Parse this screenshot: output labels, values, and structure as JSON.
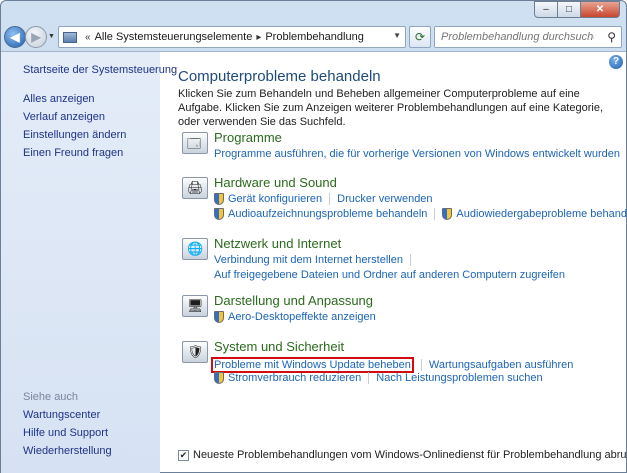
{
  "window": {
    "buttons": {
      "minimize": "–",
      "maximize": "□",
      "close": "✕"
    }
  },
  "address": {
    "crumbs": [
      "Alle Systemsteuerungselemente",
      "Problembehandlung"
    ],
    "overflow": "«"
  },
  "search": {
    "placeholder": "Problembehandlung durchsuchen"
  },
  "sidebar": {
    "home": "Startseite der Systemsteuerung",
    "links": [
      "Alles anzeigen",
      "Verlauf anzeigen",
      "Einstellungen ändern",
      "Einen Freund fragen"
    ],
    "see_also_title": "Siehe auch",
    "see_also": [
      "Wartungscenter",
      "Hilfe und Support",
      "Wiederherstellung"
    ]
  },
  "main": {
    "title": "Computerprobleme behandeln",
    "description": "Klicken Sie zum Behandeln und Beheben allgemeiner Computerprobleme auf eine Aufgabe. Klicken Sie zum Anzeigen weiterer Problembehandlungen auf eine Kategorie, oder verwenden Sie das Suchfeld.",
    "categories": [
      {
        "title": "Programme",
        "icon": "programs-icon",
        "links": [
          [
            "Programme ausführen, die für vorherige Versionen von Windows entwickelt wurden"
          ]
        ]
      },
      {
        "title": "Hardware und Sound",
        "icon": "hardware-sound-icon",
        "links": [
          [
            "Gerät konfigurieren",
            "Drucker verwenden"
          ],
          [
            "Audioaufzeichnungsprobleme behandeln",
            "Audiowiedergabeprobleme behandeln"
          ]
        ]
      },
      {
        "title": "Netzwerk und Internet",
        "icon": "network-icon",
        "links": [
          [
            "Verbindung mit dem Internet herstellen"
          ],
          [
            "Auf freigegebene Dateien und Ordner auf anderen Computern zugreifen"
          ]
        ]
      },
      {
        "title": "Darstellung und Anpassung",
        "icon": "appearance-icon",
        "links": [
          [
            "Aero-Desktopeffekte anzeigen"
          ]
        ]
      },
      {
        "title": "System und Sicherheit",
        "icon": "system-security-icon",
        "links": [
          [
            "Probleme mit Windows Update beheben",
            "Wartungsaufgaben ausführen"
          ],
          [
            "Stromverbrauch reduzieren",
            "Nach Leistungsproblemen suchen"
          ]
        ]
      }
    ],
    "footer_checkbox": "Neueste Problembehandlungen vom Windows-Onlinedienst für Problembehandlung abrufen",
    "footer_checked": true
  },
  "colors": {
    "category_title": "#2b6a1e",
    "link": "#1c64b5",
    "highlight_border": "#d10d12"
  }
}
